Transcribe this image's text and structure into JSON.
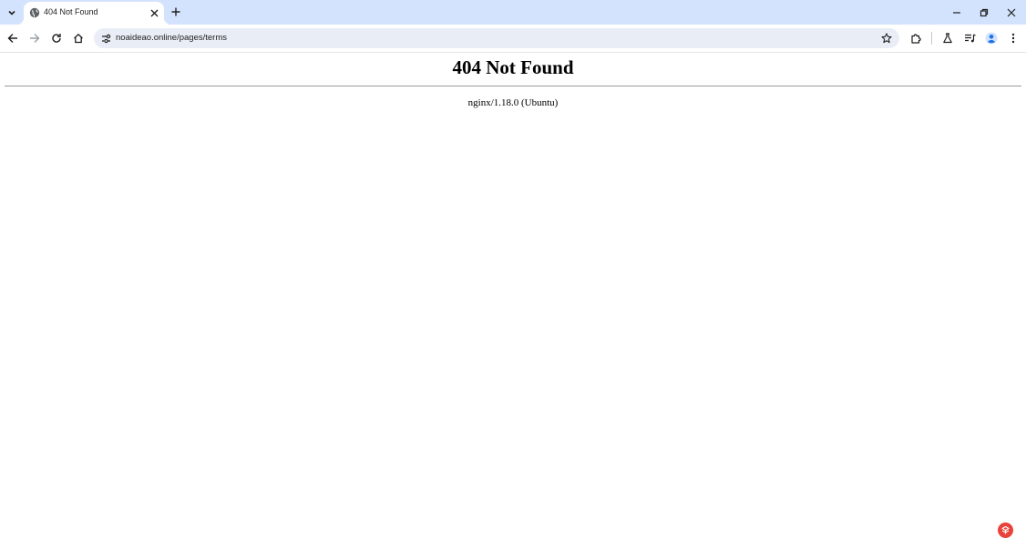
{
  "browser": {
    "tab": {
      "title": "404 Not Found"
    },
    "address_bar": {
      "url": "noaideao.online/pages/terms"
    }
  },
  "page": {
    "heading": "404 Not Found",
    "server": "nginx/1.18.0 (Ubuntu)"
  },
  "icons": [
    "tab-list-icon",
    "globe-icon",
    "close-icon",
    "plus-icon",
    "minimize-icon",
    "restore-icon",
    "window-close-icon",
    "back-icon",
    "forward-icon",
    "reload-icon",
    "home-icon",
    "site-info-icon",
    "star-icon",
    "extensions-icon",
    "labs-icon",
    "media-icon",
    "profile-icon",
    "menu-icon",
    "extension-badge-icon"
  ],
  "colors": {
    "tabstrip": "#d3e3fd",
    "omnibox": "#e9eef6",
    "profile": "#1a73e8",
    "badge": "#e8423a"
  }
}
